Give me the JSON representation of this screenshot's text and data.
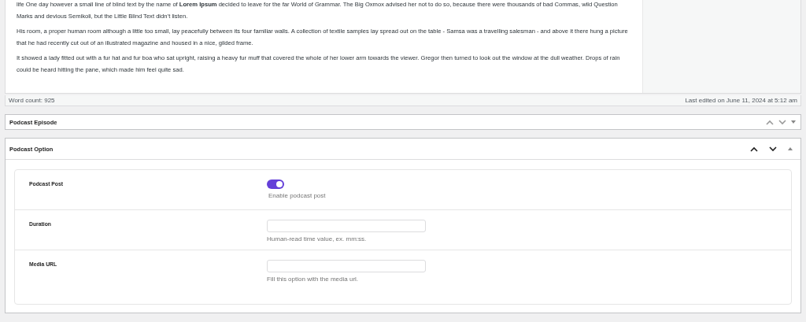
{
  "editor": {
    "paragraphs": [
      "life One day however a small line of blind text by the name of **Lorem Ipsum** decided to leave for the far World of Grammar. The Big Oxmox advised her not to do so, because there were thousands of bad Commas, wild Question Marks and devious Semikoli, but the Little Blind Text didn’t listen.",
      "His room, a proper human room although a little too small, lay peacefully between its four familiar walls. A collection of textile samples lay spread out on the table - Samsa was a travelling salesman - and above it there hung a picture that he had recently cut out of an illustrated magazine and housed in a nice, gilded frame.",
      "It showed a lady fitted out with a fur hat and fur boa who sat upright, raising a heavy fur muff that covered the whole of her lower arm towards the viewer. Gregor then turned to look out the window at the dull weather. Drops of rain could be heard hitting the pane, which made him feel quite sad."
    ],
    "word_count": "Word count: 925",
    "last_edited": "Last edited on June 11, 2024 at 5:12 am"
  },
  "panels": [
    {
      "title": "Podcast Episode",
      "expanded": false
    },
    {
      "title": "Podcast Option",
      "expanded": true,
      "fields": [
        {
          "kind": "toggle",
          "label": "Podcast Post",
          "on": true,
          "help": "Enable podcast post"
        },
        {
          "kind": "text",
          "label": "Duration",
          "help": "Human-read time value, ex. mm:ss."
        },
        {
          "kind": "text",
          "label": "Media URL",
          "help": "Fill this option with the media url."
        }
      ]
    }
  ]
}
